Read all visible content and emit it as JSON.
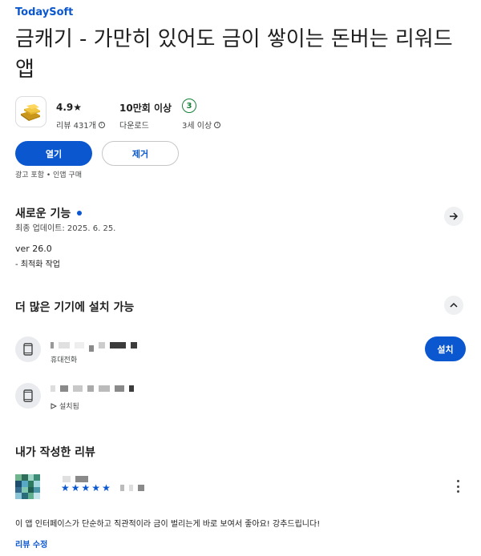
{
  "app": {
    "developer": "TodaySoft",
    "title": "금캐기 - 가만히 있어도 금이 쌓이는 돈버는 리워드 앱",
    "icon": "gold-bars-icon"
  },
  "stats": {
    "rating_value": "4.9★",
    "rating_label": "리뷰 431개",
    "downloads_value": "10만회 이상",
    "downloads_label": "다운로드",
    "age_value": "3",
    "age_label": "3세 이상"
  },
  "actions": {
    "open_label": "열기",
    "remove_label": "제거",
    "ads_note": "광고 포함 • 인앱 구매"
  },
  "whats_new": {
    "title": "새로운 기능",
    "updated": "최종 업데이트: 2025. 6. 25.",
    "version": "ver 26.0",
    "notes": "- 최적화 작업"
  },
  "devices": {
    "title": "더 많은 기기에 설치 가능",
    "items": [
      {
        "subtitle": "휴대전화",
        "action": "설치"
      },
      {
        "subtitle": "설치됨"
      }
    ]
  },
  "my_review": {
    "title": "내가 작성한 리뷰",
    "stars": 5,
    "text": "이 앱 인터페이스가 단순하고 직관적이라 금이 벌리는게 바로 보여서 좋아요! 강추드립니다!",
    "edit_label": "리뷰 수정"
  },
  "colors": {
    "accent": "#0b57d0",
    "age_green": "#188038"
  }
}
